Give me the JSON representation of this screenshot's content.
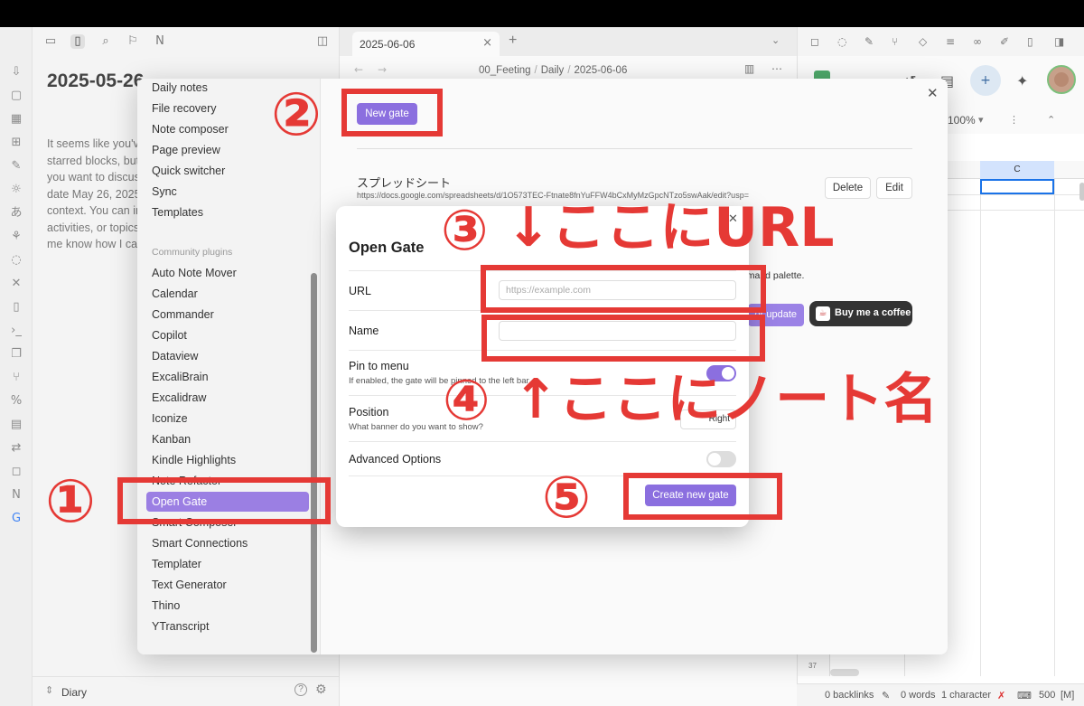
{
  "file_tab": {
    "title": "2025-06-06"
  },
  "breadcrumb": [
    "00_Feeting",
    "Daily",
    "2025-06-06"
  ],
  "left_note": {
    "title": "2025-05-26",
    "lines": [
      "It seems like you've",
      "starred blocks, but",
      "you want to discuss",
      "date May 26, 2025",
      "context. You can in",
      "activities, or topics",
      "me know how I can"
    ]
  },
  "vault": {
    "name": "Diary"
  },
  "settings": {
    "core_plugins": [
      "Daily notes",
      "File recovery",
      "Note composer",
      "Page preview",
      "Quick switcher",
      "Sync",
      "Templates"
    ],
    "community_header": "Community plugins",
    "community_plugins": [
      "Auto Note Mover",
      "Calendar",
      "Commander",
      "Copilot",
      "Dataview",
      "ExcaliBrain",
      "Excalidraw",
      "Iconize",
      "Kanban",
      "Kindle Highlights",
      "Note Refactor",
      "Open Gate",
      "Smart Composer",
      "Smart Connections",
      "Templater",
      "Text Generator",
      "Thino",
      "YTranscript"
    ],
    "active_plugin": "Open Gate",
    "new_gate_label": "New gate",
    "gate": {
      "name": "スプレッドシート",
      "url": "https://docs.google.com/spreadsheets/d/1O573TEC-Ftnate8fnYuFFW4bCxMyMzGpcNTzo5swAak/edit?usp=",
      "delete_label": "Delete",
      "edit_label": "Edit"
    },
    "hint_text": "mmand palette.",
    "update_label": "or update",
    "coffee_label": "Buy me a coffee"
  },
  "modal": {
    "title": "Open Gate",
    "url_label": "URL",
    "url_placeholder": "https://example.com",
    "name_label": "Name",
    "name_value": "",
    "pin_label": "Pin to menu",
    "pin_desc": "If enabled, the gate will be pinned to the left bar",
    "pin_on": true,
    "position_label": "Position",
    "position_desc": "What banner do you want to show?",
    "position_value": "Right",
    "advanced_label": "Advanced Options",
    "advanced_on": false,
    "create_label": "Create new gate"
  },
  "annotations": {
    "n1": "①",
    "n2": "②",
    "n3": "③",
    "n3_text": "↓ここにURL",
    "n4": "④",
    "n4_text": "↑ここにノート名",
    "n5": "⑤",
    "color": "#e53935"
  },
  "sheet": {
    "zoom": "100%",
    "col_label": "C",
    "row_label": "37"
  },
  "status": {
    "backlinks": "0 backlinks",
    "words": "0 words",
    "characters": "1 character",
    "count": "500",
    "mode": "[M]"
  }
}
